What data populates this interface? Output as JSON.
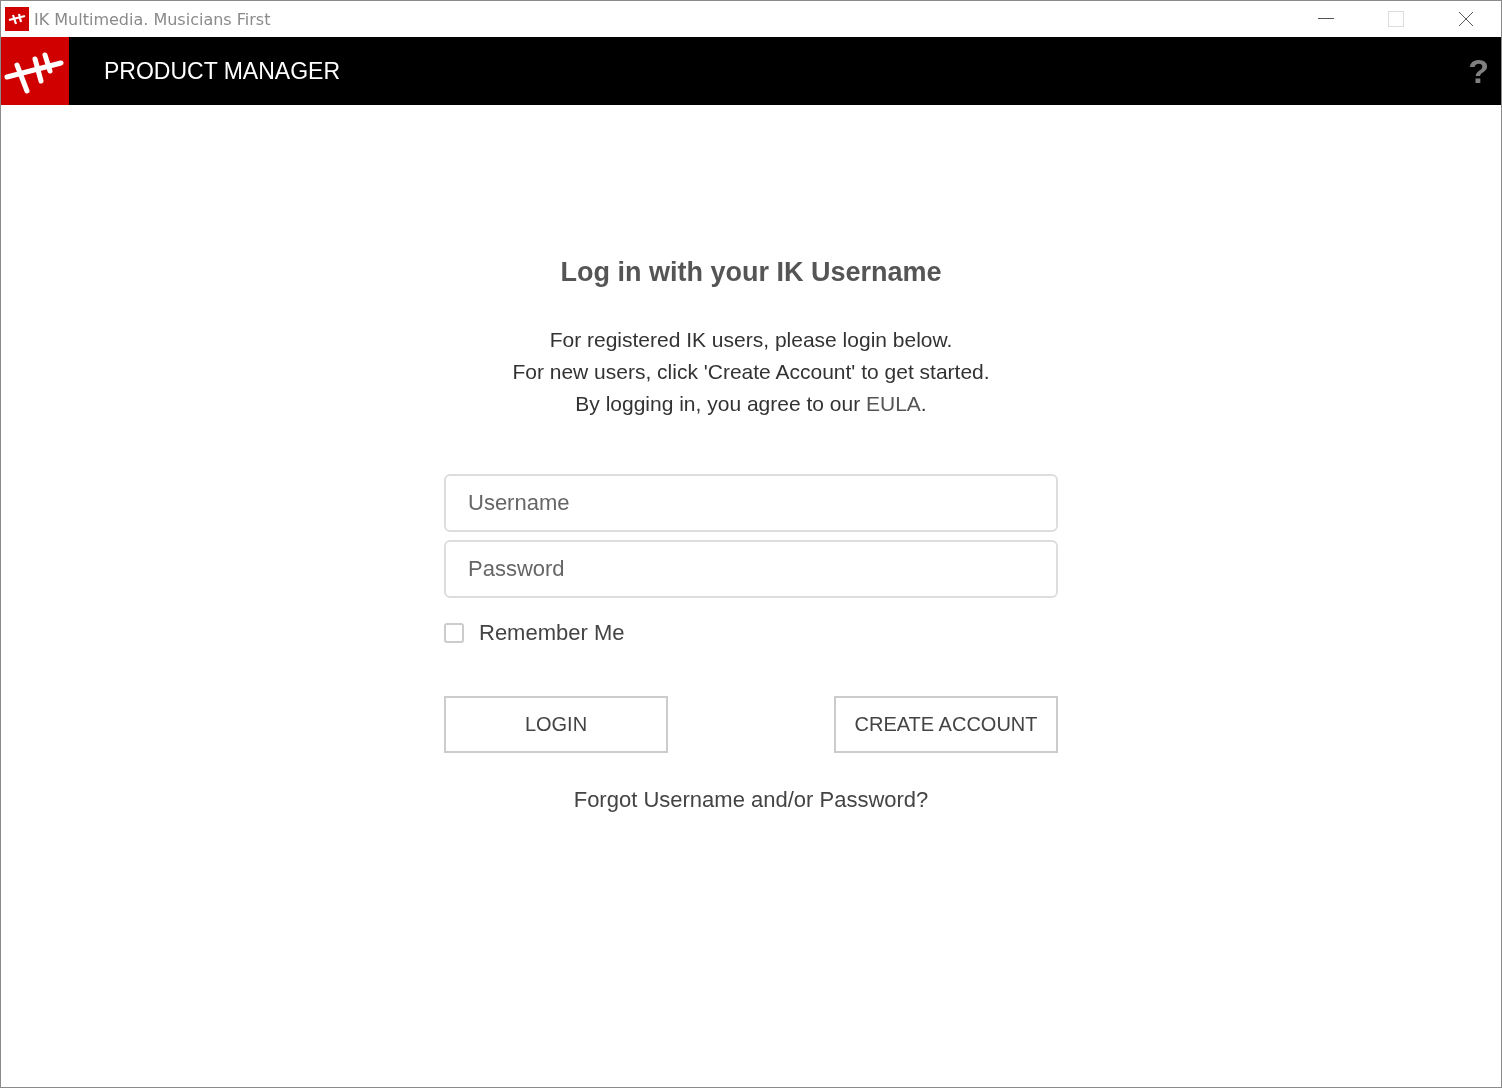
{
  "window": {
    "title": "IK Multimedia. Musicians First"
  },
  "header": {
    "title": "PRODUCT MANAGER",
    "help": "?"
  },
  "login": {
    "heading": "Log in with your IK Username",
    "intro": [
      "For registered IK users, please login below.",
      "For new users, click 'Create Account' to get started."
    ],
    "eula_line": {
      "before": "By logging in, you agree to our ",
      "link": "EULA",
      "after": "."
    },
    "fields": [
      {
        "placeholder": "Username"
      },
      {
        "placeholder": "Password"
      }
    ],
    "remember": {
      "label": "Remember Me",
      "checked": false
    },
    "buttons": [
      "LOGIN",
      "CREATE ACCOUNT"
    ],
    "forgot": "Forgot Username and/or Password?"
  }
}
